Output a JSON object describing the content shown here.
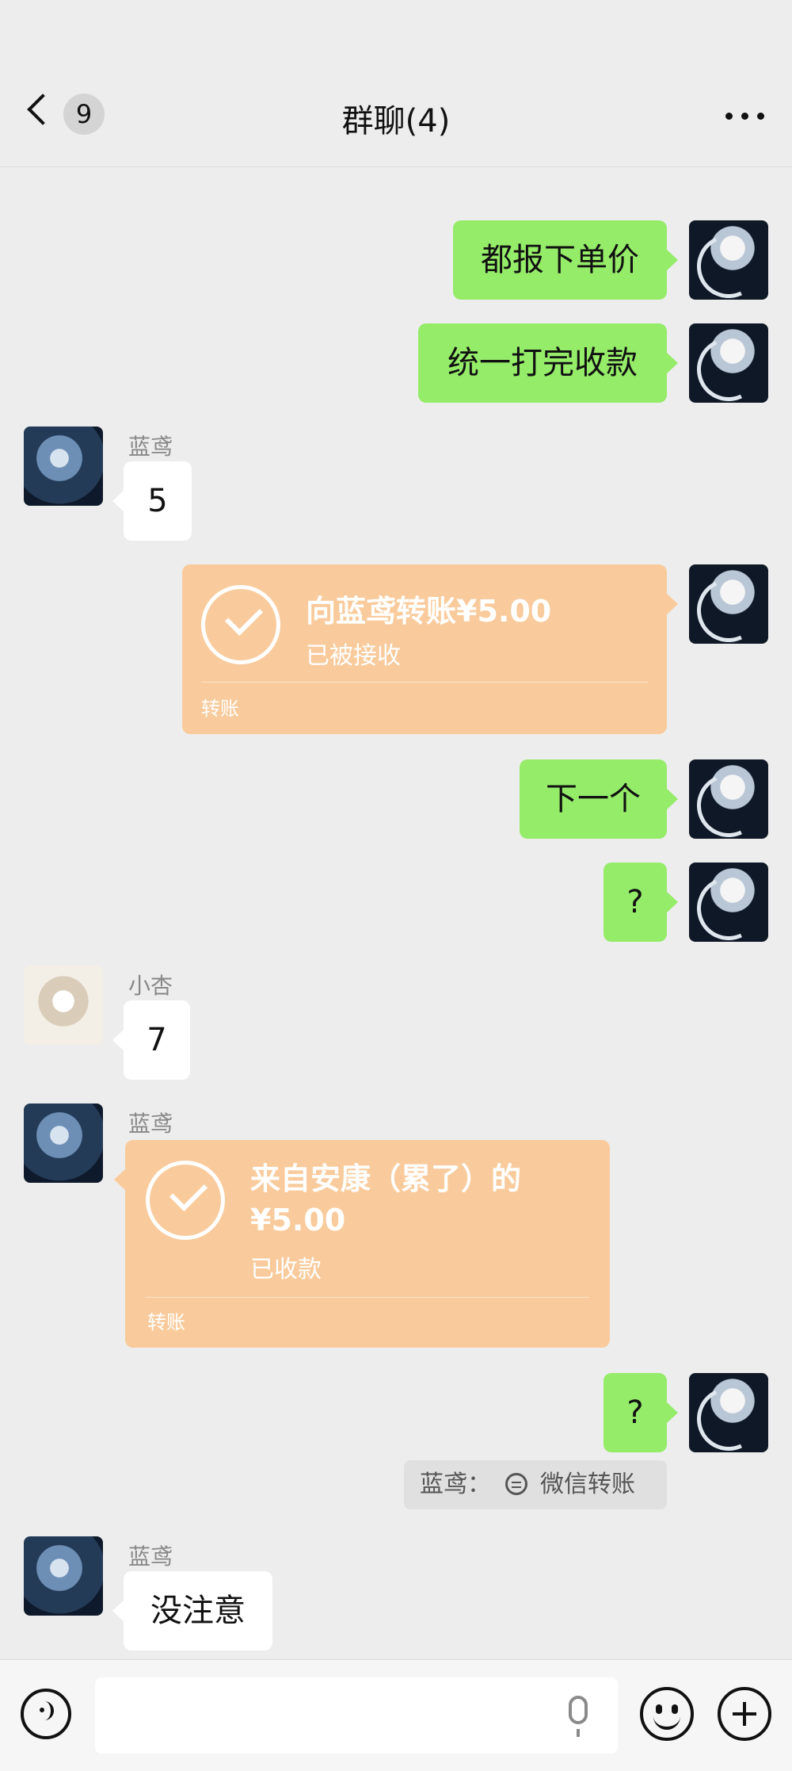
{
  "header": {
    "back_count": "9",
    "title": "群聊(4)"
  },
  "messages": [
    {
      "sender": "me",
      "text": "都报下单价"
    },
    {
      "sender": "me",
      "text": "统一打完收款"
    },
    {
      "sender": "蓝鸢",
      "text": "5"
    },
    {
      "sender": "me",
      "type": "transfer",
      "title": "向蓝鸢转账¥5.00",
      "status": "已被接收",
      "footer": "转账"
    },
    {
      "sender": "me",
      "text": "下一个"
    },
    {
      "sender": "me",
      "text": "?"
    },
    {
      "sender": "小杏",
      "text": "7"
    },
    {
      "sender": "蓝鸢",
      "type": "transfer",
      "title_line1": "来自安康（累了）的",
      "title_line2": "¥5.00",
      "status": "已收款",
      "footer": "转账"
    },
    {
      "sender": "me",
      "text": "?"
    },
    {
      "sender": "蓝鸢",
      "text": "没注意"
    }
  ],
  "system_notice": {
    "who": "蓝鸢：",
    "text": "微信转账"
  },
  "icons": {
    "back": "chevron-left-icon",
    "more": "more-dots-icon",
    "check": "check-circle-icon",
    "swap": "transfer-swap-icon",
    "voice": "voice-icon",
    "mic": "microphone-icon",
    "emoji": "emoji-icon",
    "plus": "plus-icon"
  },
  "colors": {
    "background": "#ededed",
    "my_bubble": "#95ec69",
    "other_bubble": "#ffffff",
    "transfer_card": "#f9cb9c"
  }
}
